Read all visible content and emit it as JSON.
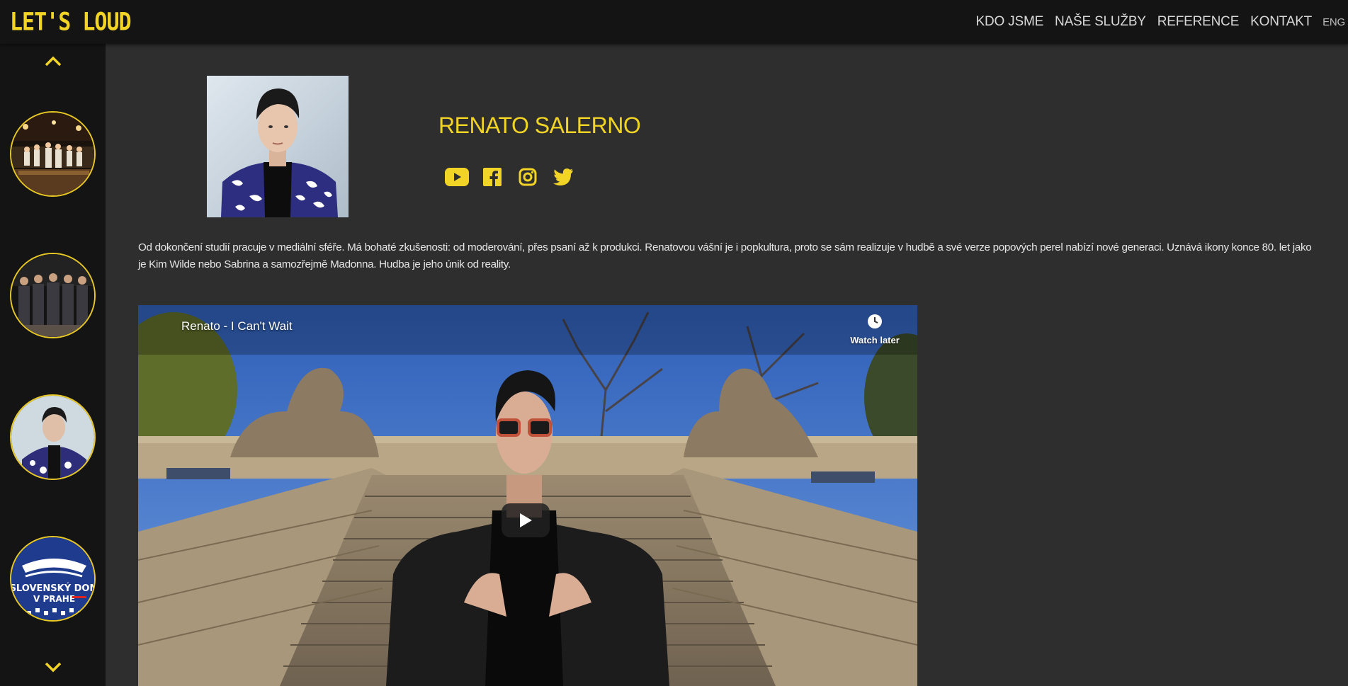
{
  "header": {
    "logo": "LET'S LOUD",
    "nav": [
      "KDO JSME",
      "NAŠE SLUŽBY",
      "REFERENCE",
      "KONTAKT"
    ],
    "lang": "ENG"
  },
  "sidebar": {
    "thumbnails": [
      {
        "name": "orchestra"
      },
      {
        "name": "band"
      },
      {
        "name": "renato"
      },
      {
        "name": "slovensky-dom",
        "text_line1": "SLOVENSKÝ DOM",
        "text_line2": "V PRAHE"
      }
    ]
  },
  "profile": {
    "name": "RENATO SALERNO",
    "bio": "Od dokončení studií pracuje v mediální sféře. Má bohaté zkušenosti: od moderování, přes psaní až k produkci. Renatovou vášní je i popkultura, proto se sám realizuje v hudbě a své verze popových perel nabízí nové generaci. Uznává ikony konce 80. let jako je Kim Wilde nebo Sabrina a samozřejmě Madonna. Hudba je jeho únik od reality.",
    "socials": [
      "youtube-icon",
      "facebook-icon",
      "instagram-icon",
      "twitter-icon"
    ]
  },
  "video": {
    "title": "Renato - I Can't Wait",
    "watch_later": "Watch later"
  },
  "colors": {
    "accent": "#f2d427",
    "header_bg": "#141414",
    "main_bg": "#2e2e2e"
  }
}
